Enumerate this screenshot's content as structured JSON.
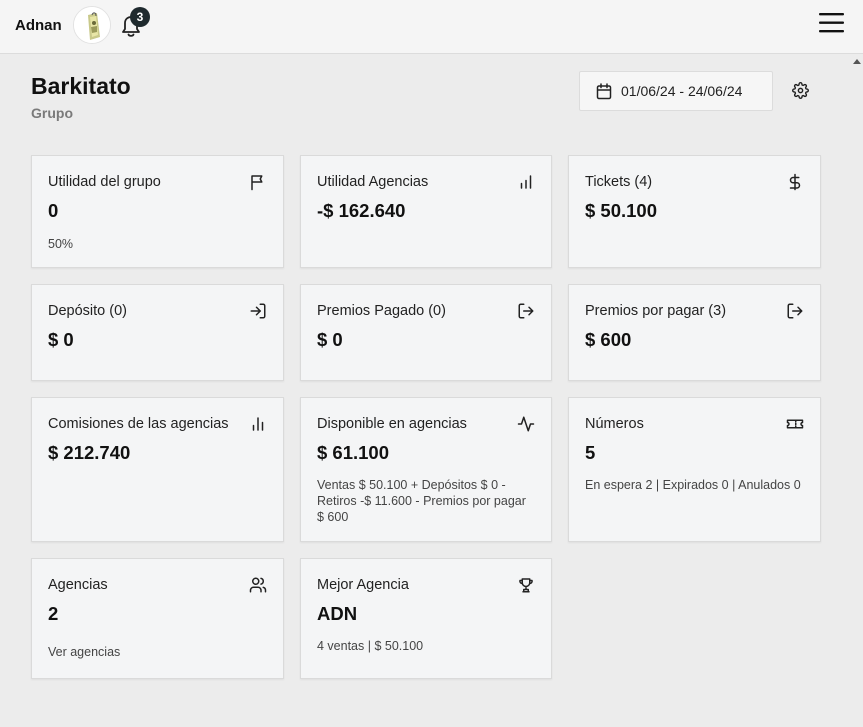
{
  "header": {
    "username": "Adnan",
    "notifications_count": "3"
  },
  "page": {
    "title": "Barkitato",
    "subtitle": "Grupo",
    "date_range": "01/06/24 - 24/06/24"
  },
  "cards": {
    "utilidad_grupo": {
      "title": "Utilidad del grupo",
      "value": "0",
      "note": "50%"
    },
    "utilidad_agencias": {
      "title": "Utilidad Agencias",
      "value": "-$ 162.640"
    },
    "tickets": {
      "title": "Tickets (4)",
      "value": "$ 50.100"
    },
    "deposito": {
      "title": "Depósito (0)",
      "value": "$ 0"
    },
    "premios_pagado": {
      "title": "Premios Pagado (0)",
      "value": "$ 0"
    },
    "premios_por_pagar": {
      "title": "Premios por pagar (3)",
      "value": "$ 600"
    },
    "comisiones": {
      "title": "Comisiones de las agencias",
      "value": "$ 212.740"
    },
    "disponible": {
      "title": "Disponible en agencias",
      "value": "$ 61.100",
      "note_lines": [
        "Ventas $ 50.100 + Depósitos $ 0 -",
        "Retiros -$ 11.600 - Premios por pagar",
        "$ 600"
      ]
    },
    "numeros": {
      "title": "Números",
      "value": "5",
      "note": "En espera 2 | Expirados 0 | Anulados 0"
    },
    "agencias": {
      "title": "Agencias",
      "value": "2",
      "link": "Ver agencias"
    },
    "mejor_agencia": {
      "title": "Mejor Agencia",
      "value": "ADN",
      "note": "4 ventas | $ 50.100"
    }
  },
  "icons": {
    "utilidad_grupo": "flag-icon",
    "utilidad_agencias": "bar-chart-icon",
    "tickets": "dollar-icon",
    "deposito": "login-icon",
    "premios_pagado": "logout-icon",
    "premios_por_pagar": "logout-icon",
    "comisiones": "bar-chart-icon",
    "disponible": "activity-icon",
    "numeros": "ticket-icon",
    "agencias": "users-icon",
    "mejor_agencia": "trophy-icon"
  },
  "colors": {
    "background": "#ececec",
    "card": "#f4f5f6",
    "topbar": "#f5f5f5",
    "badge": "#1f2a2e"
  }
}
